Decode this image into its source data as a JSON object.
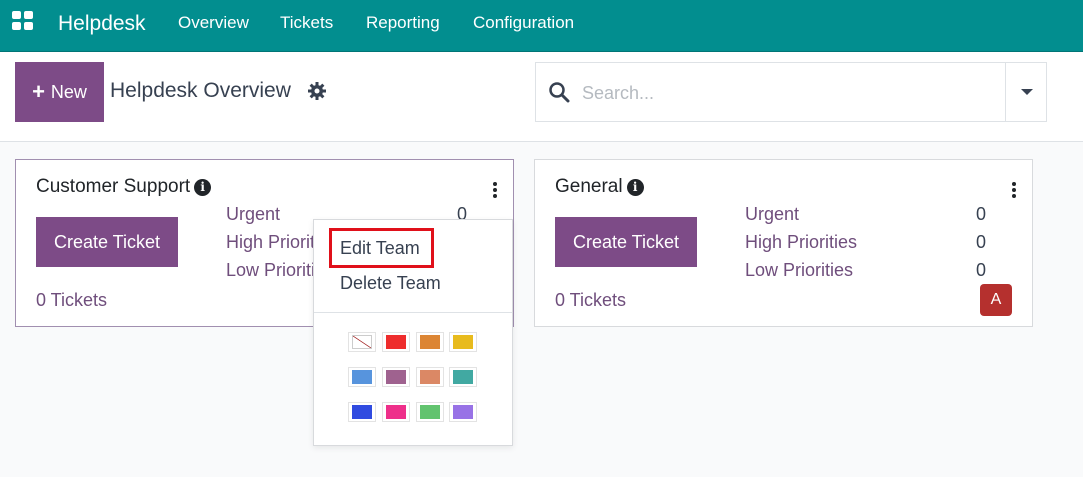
{
  "navbar": {
    "brand": "Helpdesk",
    "menu": [
      "Overview",
      "Tickets",
      "Reporting",
      "Configuration"
    ]
  },
  "control_panel": {
    "new_label": "New",
    "title": "Helpdesk Overview",
    "search_placeholder": "Search..."
  },
  "teams": [
    {
      "name": "Customer Support",
      "create_label": "Create Ticket",
      "stats": [
        {
          "label": "Urgent",
          "value": "0"
        },
        {
          "label": "High Priorities",
          "value": ""
        },
        {
          "label": "Low Priorities",
          "value": ""
        }
      ],
      "tickets": "0 Tickets"
    },
    {
      "name": "General",
      "create_label": "Create Ticket",
      "stats": [
        {
          "label": "Urgent",
          "value": "0"
        },
        {
          "label": "High Priorities",
          "value": "0"
        },
        {
          "label": "Low Priorities",
          "value": "0"
        }
      ],
      "tickets": "0 Tickets",
      "avatar": "A"
    }
  ],
  "dropdown": {
    "edit_label": "Edit Team",
    "delete_label": "Delete Team",
    "colors": [
      "none",
      "#ee2d2d",
      "#dc8534",
      "#e8bb1d",
      "#5794dd",
      "#9f628f",
      "#db8865",
      "#41a9a2",
      "#304be0",
      "#ee2f8a",
      "#61c36e",
      "#9872e6"
    ]
  },
  "accent_color": "#7d4b87",
  "navbar_color": "#028e8f"
}
